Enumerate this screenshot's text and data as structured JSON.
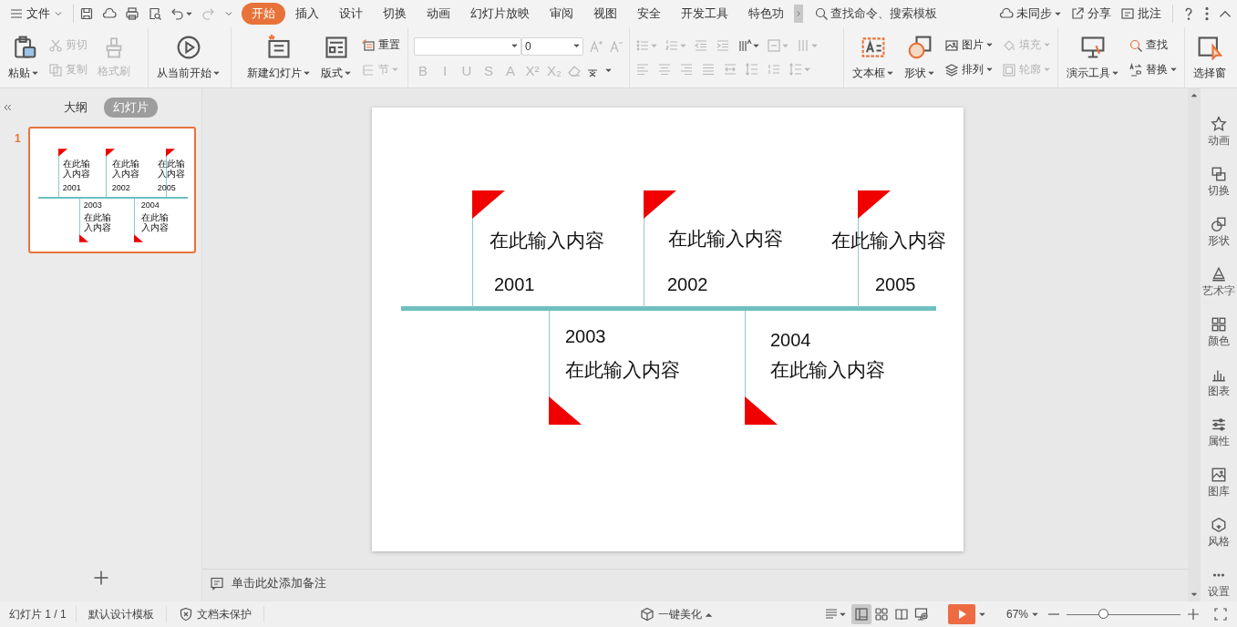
{
  "title_bar": {
    "file_menu": "文件"
  },
  "tabs": [
    {
      "label": "开始",
      "selected": true
    },
    {
      "label": "插入",
      "selected": false
    },
    {
      "label": "设计",
      "selected": false
    },
    {
      "label": "切换",
      "selected": false
    },
    {
      "label": "动画",
      "selected": false
    },
    {
      "label": "幻灯片放映",
      "selected": false
    },
    {
      "label": "审阅",
      "selected": false
    },
    {
      "label": "视图",
      "selected": false
    },
    {
      "label": "安全",
      "selected": false
    },
    {
      "label": "开发工具",
      "selected": false
    },
    {
      "label": "特色功",
      "selected": false
    }
  ],
  "search": {
    "placeholder": "查找命令、搜索模板"
  },
  "account": {
    "sync": "未同步",
    "share": "分享",
    "comment": "批注"
  },
  "ribbon": {
    "paste": {
      "label": "粘贴",
      "disabled": false
    },
    "cut": {
      "label": "剪切",
      "disabled": true
    },
    "copy": {
      "label": "复制",
      "disabled": true
    },
    "format_painter": {
      "label": "格式刷",
      "disabled": true
    },
    "play_from_current": {
      "label": "从当前开始"
    },
    "new_slide": {
      "label": "新建幻灯片"
    },
    "layout": {
      "label": "版式"
    },
    "reset": {
      "label": "重置",
      "disabled": false
    },
    "section": {
      "label": "节",
      "disabled": true
    },
    "font_size": {
      "value": "0"
    },
    "format_buttons": [
      {
        "label": "B",
        "disabled": true
      },
      {
        "label": "I",
        "disabled": true
      },
      {
        "label": "U",
        "disabled": true
      },
      {
        "label": "S",
        "disabled": true
      },
      {
        "label": "A",
        "disabled": true
      },
      {
        "label": "X²",
        "disabled": true
      },
      {
        "label": "X₂",
        "disabled": true
      }
    ],
    "text_box": {
      "label": "文本框"
    },
    "shape": {
      "label": "形状"
    },
    "picture": {
      "label": "图片",
      "disabled": false
    },
    "fill": {
      "label": "填充",
      "disabled": true
    },
    "arrange": {
      "label": "排列",
      "disabled": false
    },
    "outline": {
      "label": "轮廓",
      "disabled": true
    },
    "presentation_tools": {
      "label": "演示工具"
    },
    "find": {
      "label": "查找"
    },
    "replace": {
      "label": "替换"
    },
    "selection_pane": {
      "label": "选择窗"
    }
  },
  "slide_panel": {
    "tabs": [
      {
        "label": "大纲",
        "selected": false
      },
      {
        "label": "幻灯片",
        "selected": true
      }
    ],
    "slide_number": "1"
  },
  "slide": {
    "items": [
      {
        "kind": "up",
        "text": "在此输入内容",
        "year": "2001"
      },
      {
        "kind": "up",
        "text": "在此输入内容",
        "year": "2002"
      },
      {
        "kind": "up",
        "text": "在此输入内容",
        "year": "2005"
      },
      {
        "kind": "down",
        "text": "在此输入内容",
        "year": "2003"
      },
      {
        "kind": "down",
        "text": "在此输入内容",
        "year": "2004"
      }
    ]
  },
  "slide_thumbnail": {
    "items": [
      {
        "kind": "up",
        "text": "在此输入内容",
        "year": "2001"
      },
      {
        "kind": "up",
        "text": "在此输入内容",
        "year": "2002"
      },
      {
        "kind": "up",
        "text": "在此输入内容",
        "year": "2005"
      },
      {
        "kind": "down",
        "text": "在此输入内容",
        "year": "2003"
      },
      {
        "kind": "down",
        "text": "在此输入内容",
        "year": "2004"
      }
    ]
  },
  "notes": {
    "placeholder": "单击此处添加备注"
  },
  "right_sidebar": [
    "动画",
    "切换",
    "形状",
    "艺术字",
    "颜色",
    "图表",
    "属性",
    "图库",
    "风格",
    "设置"
  ],
  "status_bar": {
    "slide_counter": "幻灯片 1 / 1",
    "template": "默认设计模板",
    "protection": "文档未保护",
    "beautify": "一键美化",
    "views": [
      {
        "selected": true
      },
      {
        "selected": false
      },
      {
        "selected": false
      },
      {
        "selected": false
      }
    ],
    "zoom": "67%",
    "zoom_slider": {
      "level": 0.33
    }
  }
}
